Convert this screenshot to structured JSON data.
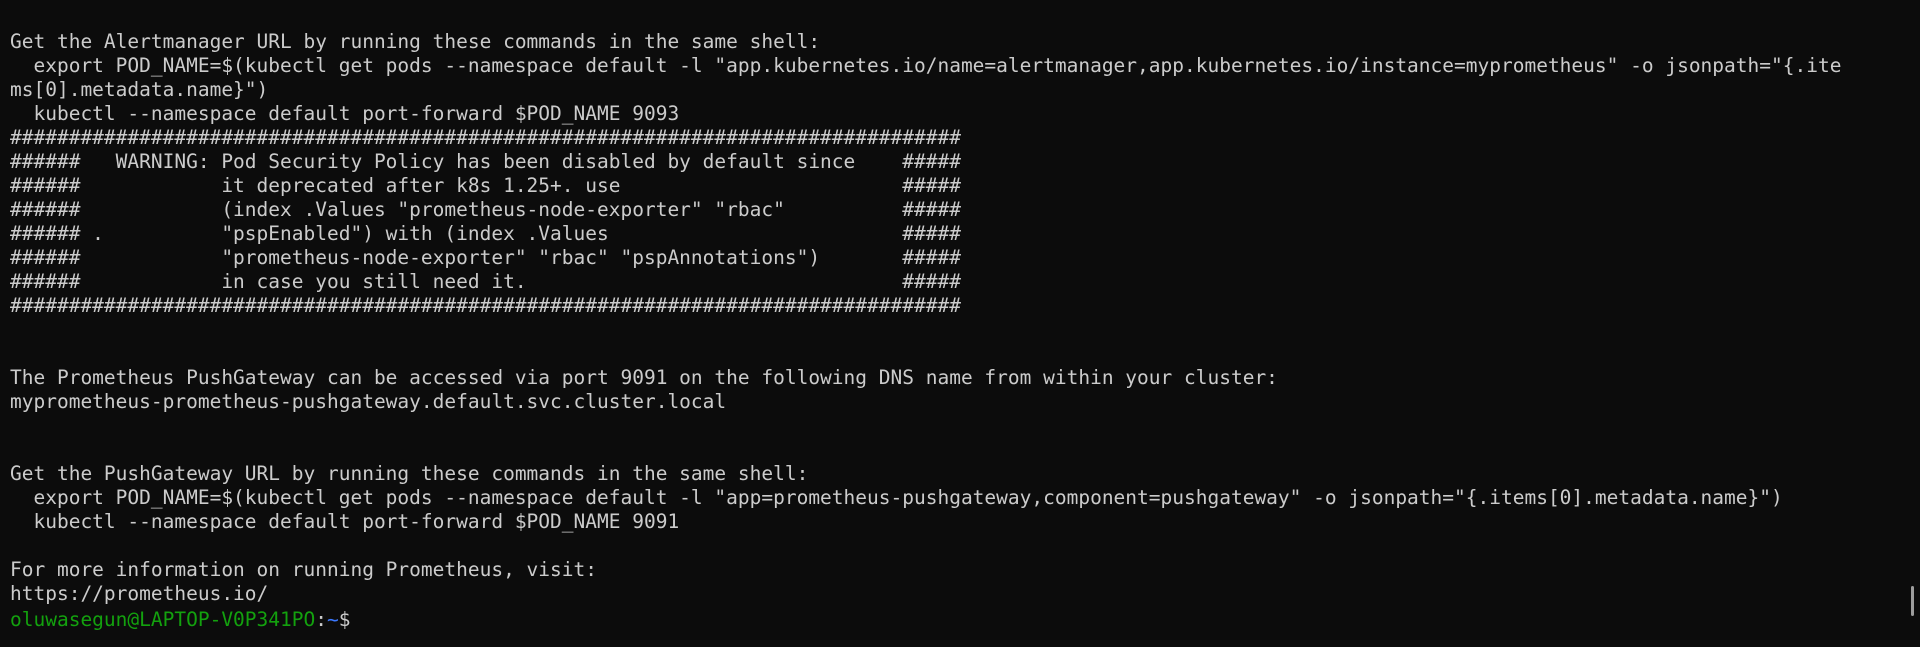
{
  "terminal": {
    "lines": [
      "Get the Alertmanager URL by running these commands in the same shell:",
      "  export POD_NAME=$(kubectl get pods --namespace default -l \"app.kubernetes.io/name=alertmanager,app.kubernetes.io/instance=myprometheus\" -o jsonpath=\"{.ite",
      "ms[0].metadata.name}\")",
      "  kubectl --namespace default port-forward $POD_NAME 9093",
      "#################################################################################",
      "######   WARNING: Pod Security Policy has been disabled by default since    #####",
      "######            it deprecated after k8s 1.25+. use                        #####",
      "######            (index .Values \"prometheus-node-exporter\" \"rbac\"          #####",
      "###### .          \"pspEnabled\") with (index .Values                         #####",
      "######            \"prometheus-node-exporter\" \"rbac\" \"pspAnnotations\")       #####",
      "######            in case you still need it.                                #####",
      "#################################################################################",
      "",
      "",
      "The Prometheus PushGateway can be accessed via port 9091 on the following DNS name from within your cluster:",
      "myprometheus-prometheus-pushgateway.default.svc.cluster.local",
      "",
      "",
      "Get the PushGateway URL by running these commands in the same shell:",
      "  export POD_NAME=$(kubectl get pods --namespace default -l \"app=prometheus-pushgateway,component=pushgateway\" -o jsonpath=\"{.items[0].metadata.name}\")",
      "  kubectl --namespace default port-forward $POD_NAME 9091",
      "",
      "For more information on running Prometheus, visit:",
      "https://prometheus.io/"
    ],
    "prompt": {
      "user_host": "oluwasegun@LAPTOP-V0P341PO",
      "colon": ":",
      "path": "~",
      "sign": "$"
    },
    "colors": {
      "background": "#0c0c0c",
      "text": "#cccccc",
      "user_host": "#13a10e",
      "path": "#3b78ff"
    }
  }
}
